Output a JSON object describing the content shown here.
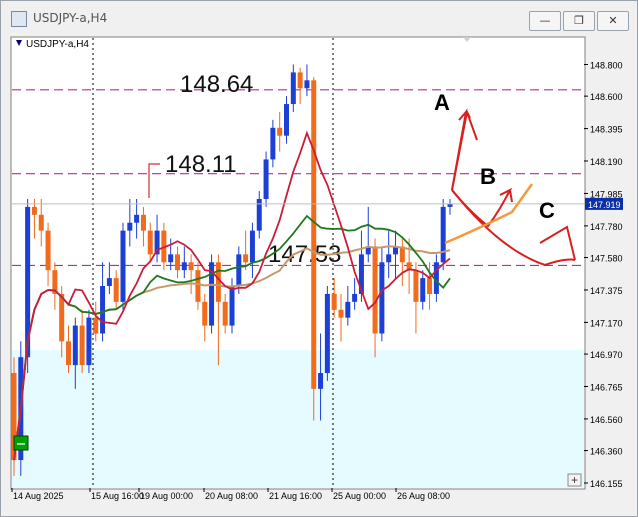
{
  "window": {
    "title": "USDJPY-a,H4",
    "minimize_label": "—",
    "restore_label": "❐",
    "close_label": "✕",
    "icon": "chart-window-icon"
  },
  "chart_data": {
    "type": "candlestick",
    "title": "USDJPY-a,H4",
    "symbol_label": "USDJPY-a,H4",
    "ylim": [
      146.155,
      148.86
    ],
    "y_ticks": [
      "148.800",
      "148.600",
      "148.395",
      "148.190",
      "147.985",
      "147.780",
      "147.580",
      "147.375",
      "147.170",
      "146.970",
      "146.765",
      "146.560",
      "146.360",
      "146.155"
    ],
    "x_ticks": [
      "14 Aug 2025",
      "15 Aug 16:00",
      "19 Aug 00:00",
      "20 Aug 08:00",
      "21 Aug 16:00",
      "25 Aug 00:00",
      "26 Aug 08:00"
    ],
    "current_price": "147.919",
    "price_levels": [
      {
        "label": "148.64",
        "value": 148.64
      },
      {
        "label": "148.11",
        "value": 148.11
      },
      {
        "label": "147.53",
        "value": 147.53
      }
    ],
    "scenarios": [
      "A",
      "B",
      "C"
    ],
    "candles": [
      [
        146.85,
        146.3,
        146.95,
        146.2
      ],
      [
        146.3,
        146.95,
        147.05,
        146.2
      ],
      [
        146.95,
        147.9,
        147.95,
        146.85
      ],
      [
        147.9,
        147.85,
        147.95,
        147.7
      ],
      [
        147.85,
        147.75,
        147.95,
        147.65
      ],
      [
        147.75,
        147.5,
        147.8,
        147.4
      ],
      [
        147.5,
        147.35,
        147.55,
        147.25
      ],
      [
        147.35,
        147.05,
        147.4,
        146.95
      ],
      [
        147.05,
        146.9,
        147.15,
        146.85
      ],
      [
        146.9,
        147.15,
        147.2,
        146.75
      ],
      [
        147.15,
        146.9,
        147.25,
        146.85
      ],
      [
        146.9,
        147.2,
        147.25,
        146.85
      ],
      [
        147.2,
        147.1,
        147.3,
        147.05
      ],
      [
        147.1,
        147.4,
        147.55,
        147.05
      ],
      [
        147.4,
        147.45,
        147.55,
        147.35
      ],
      [
        147.45,
        147.3,
        147.5,
        147.25
      ],
      [
        147.3,
        147.75,
        147.8,
        147.25
      ],
      [
        147.75,
        147.8,
        147.95,
        147.65
      ],
      [
        147.8,
        147.85,
        147.95,
        147.7
      ],
      [
        147.85,
        147.75,
        147.9,
        147.65
      ],
      [
        147.75,
        147.6,
        147.8,
        147.55
      ],
      [
        147.6,
        147.75,
        147.85,
        147.55
      ],
      [
        147.75,
        147.55,
        147.8,
        147.5
      ],
      [
        147.55,
        147.6,
        147.7,
        147.5
      ],
      [
        147.6,
        147.5,
        147.65,
        147.45
      ],
      [
        147.5,
        147.55,
        147.65,
        147.45
      ],
      [
        147.55,
        147.5,
        147.6,
        147.35
      ],
      [
        147.5,
        147.3,
        147.55,
        147.25
      ],
      [
        147.3,
        147.15,
        147.35,
        147.05
      ],
      [
        147.15,
        147.55,
        147.6,
        147.1
      ],
      [
        147.55,
        147.3,
        147.6,
        146.9
      ],
      [
        147.3,
        147.15,
        147.35,
        147.1
      ],
      [
        147.15,
        147.4,
        147.45,
        147.1
      ],
      [
        147.4,
        147.6,
        147.65,
        147.35
      ],
      [
        147.6,
        147.55,
        147.75,
        147.5
      ],
      [
        147.55,
        147.75,
        147.8,
        147.45
      ],
      [
        147.75,
        147.95,
        148.0,
        147.7
      ],
      [
        147.95,
        148.2,
        148.25,
        147.9
      ],
      [
        148.2,
        148.4,
        148.45,
        148.15
      ],
      [
        148.4,
        148.35,
        148.5,
        148.25
      ],
      [
        148.35,
        148.55,
        148.6,
        148.3
      ],
      [
        148.55,
        148.75,
        148.8,
        148.5
      ],
      [
        148.75,
        148.65,
        148.78,
        148.55
      ],
      [
        148.65,
        148.7,
        148.8,
        148.6
      ],
      [
        148.7,
        146.75,
        148.72,
        146.55
      ],
      [
        146.75,
        146.85,
        147.1,
        146.55
      ],
      [
        146.85,
        147.35,
        147.4,
        146.8
      ],
      [
        147.35,
        147.25,
        147.45,
        147.2
      ],
      [
        147.25,
        147.2,
        147.35,
        147.05
      ],
      [
        147.2,
        147.3,
        147.4,
        147.15
      ],
      [
        147.3,
        147.35,
        147.45,
        147.25
      ],
      [
        147.35,
        147.6,
        147.75,
        147.3
      ],
      [
        147.6,
        147.65,
        147.9,
        147.55
      ],
      [
        147.65,
        147.1,
        147.7,
        146.95
      ],
      [
        147.1,
        147.55,
        147.65,
        147.05
      ],
      [
        147.55,
        147.6,
        147.75,
        147.45
      ],
      [
        147.6,
        147.65,
        147.75,
        147.45
      ],
      [
        147.65,
        147.55,
        147.7,
        147.4
      ],
      [
        147.55,
        147.5,
        147.7,
        147.35
      ],
      [
        147.5,
        147.3,
        147.55,
        147.1
      ],
      [
        147.3,
        147.45,
        147.5,
        147.25
      ],
      [
        147.45,
        147.35,
        147.55,
        147.25
      ],
      [
        147.35,
        147.55,
        147.6,
        147.3
      ],
      [
        147.55,
        147.9,
        147.95,
        147.5
      ],
      [
        147.9,
        147.92,
        147.95,
        147.85
      ]
    ]
  }
}
